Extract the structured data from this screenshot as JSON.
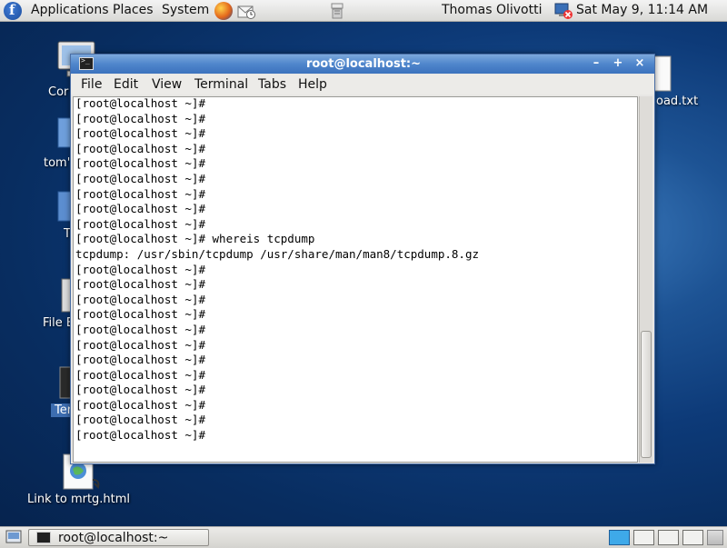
{
  "top_panel": {
    "menu": [
      "Applications",
      "Places",
      "System"
    ],
    "user": "Thomas Olivotti",
    "clock": "Sat May  9, 11:14 AM"
  },
  "desktop": {
    "icons": [
      {
        "label": "Cor"
      },
      {
        "label": "tom'"
      },
      {
        "label": "T"
      },
      {
        "label": "File B"
      },
      {
        "label": "Ter"
      },
      {
        "label": "Link to mrtg.html"
      },
      {
        "label": "oad.txt"
      }
    ]
  },
  "window": {
    "title": "root@localhost:~",
    "menu": [
      "File",
      "Edit",
      "View",
      "Terminal",
      "Tabs",
      "Help"
    ],
    "terminal_lines": [
      "[root@localhost ~]#",
      "[root@localhost ~]#",
      "[root@localhost ~]#",
      "[root@localhost ~]#",
      "[root@localhost ~]#",
      "[root@localhost ~]#",
      "[root@localhost ~]#",
      "[root@localhost ~]#",
      "[root@localhost ~]#",
      "[root@localhost ~]# whereis tcpdump",
      "tcpdump: /usr/sbin/tcpdump /usr/share/man/man8/tcpdump.8.gz",
      "[root@localhost ~]#",
      "[root@localhost ~]#",
      "[root@localhost ~]#",
      "[root@localhost ~]#",
      "[root@localhost ~]#",
      "[root@localhost ~]#",
      "[root@localhost ~]#",
      "[root@localhost ~]#",
      "[root@localhost ~]#",
      "[root@localhost ~]#",
      "[root@localhost ~]#",
      "[root@localhost ~]#"
    ]
  },
  "bottom_panel": {
    "task_label": "root@localhost:~"
  }
}
